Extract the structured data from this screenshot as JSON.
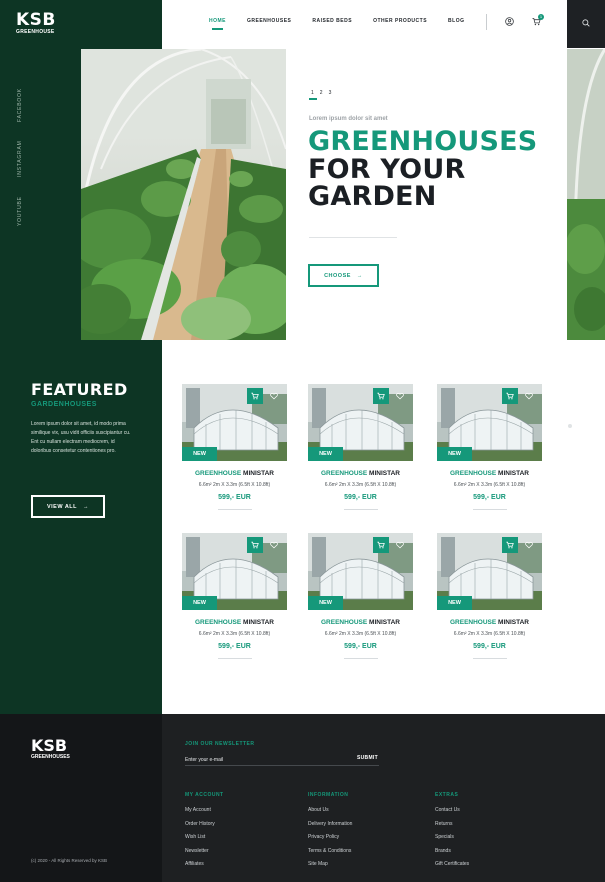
{
  "brand": {
    "logo_mark": "KSB",
    "logo_sub": "GREENHOUSE"
  },
  "social": [
    "FACEBOOK",
    "INSTAGRAM",
    "YOUTUBE"
  ],
  "nav": {
    "items": [
      "HOME",
      "GREENHOUSES",
      "RAISED BEDS",
      "OTHER PRODUCTS",
      "BLOG"
    ],
    "active": "HOME",
    "cart_count": "1"
  },
  "hero": {
    "slides": [
      "1",
      "2",
      "3"
    ],
    "kicker": "Lorem ipsum dolor sit amet",
    "headline": [
      "GREENHOUSES",
      "FOR YOUR",
      "GARDEN"
    ],
    "cta": "CHOOSE"
  },
  "featured": {
    "title": "FEATURED",
    "subtitle": "GARDENHOUSES",
    "text": "Lorem ipsum dolor sit amet, id modo prima similique vix, usu vidit officiis suscipiantur cu. Ent cu nullam electram mediocrem, id doloribus consetetur contentiones pro.",
    "button": "VIEW ALL"
  },
  "products": [
    {
      "badge": "NEW",
      "title_green": "GREENHOUSE",
      "title_dark": "MINISTAR",
      "size": "6.6m² 2m X 3.3m (6.5ft X 10.8ft)",
      "price": "599,- EUR"
    },
    {
      "badge": "NEW",
      "title_green": "GREENHOUSE",
      "title_dark": "MINISTAR",
      "size": "6.6m² 2m X 3.3m (6.5ft X 10.8ft)",
      "price": "599,- EUR"
    },
    {
      "badge": "NEW",
      "title_green": "GREENHOUSE",
      "title_dark": "MINISTAR",
      "size": "6.6m² 2m X 3.3m (6.5ft X 10.8ft)",
      "price": "599,- EUR"
    },
    {
      "badge": "NEW",
      "title_green": "GREENHOUSE",
      "title_dark": "MINISTAR",
      "size": "6.6m² 2m X 3.3m (6.5ft X 10.8ft)",
      "price": "599,- EUR"
    },
    {
      "badge": "NEW",
      "title_green": "GREENHOUSE",
      "title_dark": "MINISTAR",
      "size": "6.6m² 2m X 3.3m (6.5ft X 10.8ft)",
      "price": "599,- EUR"
    },
    {
      "badge": "NEW",
      "title_green": "GREENHOUSE",
      "title_dark": "MINISTAR",
      "size": "6.6m² 2m X 3.3m (6.5ft X 10.8ft)",
      "price": "599,- EUR"
    }
  ],
  "footer": {
    "logo_mark": "KSB",
    "logo_sub": "GREENHOUSES",
    "copyright": "(c) 2020 - All Rights Reserved by KSB",
    "newsletter_title": "JOIN OUR NEWSLETTER",
    "newsletter_placeholder": "Enter your e-mail",
    "submit": "SUBMIT",
    "columns": [
      {
        "title": "MY ACCOUNT",
        "links": [
          "My Account",
          "Order History",
          "Wish List",
          "Newsletter",
          "Affiliates"
        ]
      },
      {
        "title": "INFORMATION",
        "links": [
          "About Us",
          "Delivery Information",
          "Privacy Policy",
          "Terms & Conditions",
          "Site Map"
        ]
      },
      {
        "title": "EXTRAS",
        "links": [
          "Contact Us",
          "Returns",
          "Specials",
          "Brands",
          "Gift Certificates"
        ]
      }
    ]
  },
  "colors": {
    "accent": "#15987a",
    "dark_green": "#0d3524",
    "footer_dark": "#1e2022",
    "text": "#1b1f24"
  }
}
